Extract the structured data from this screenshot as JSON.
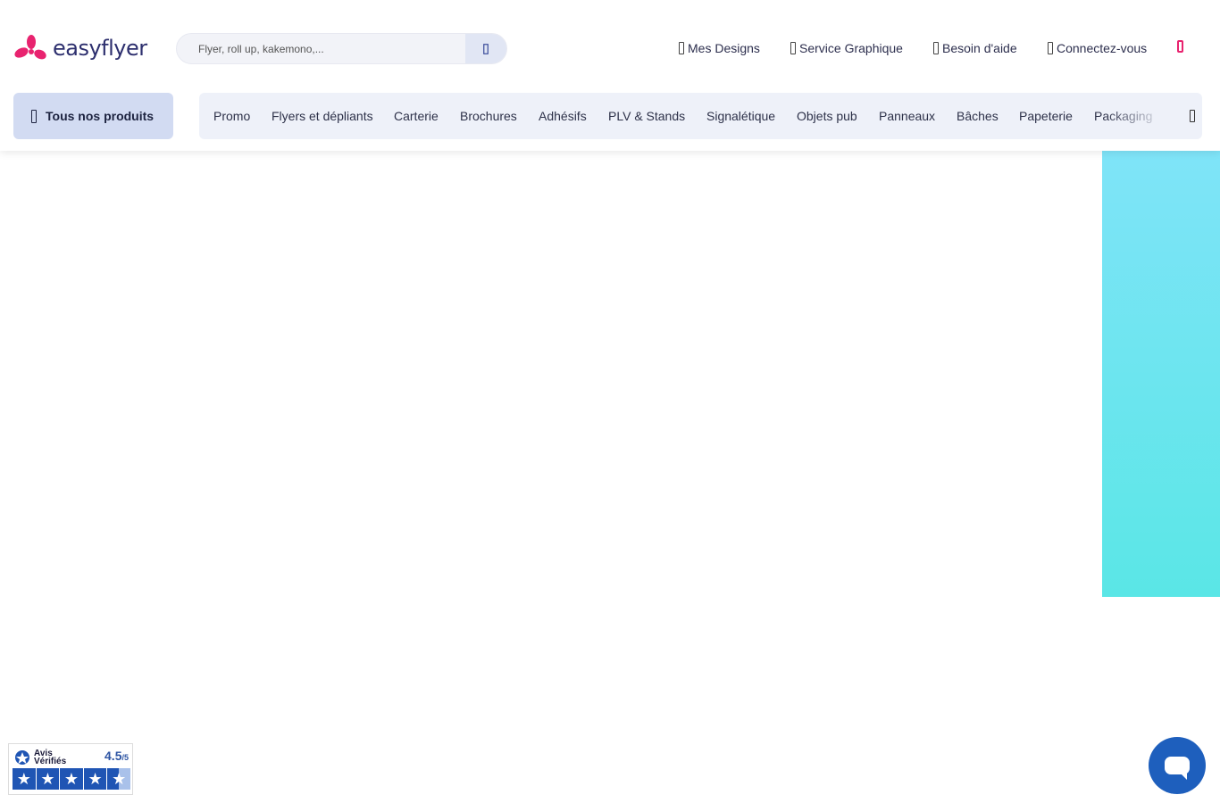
{
  "brand": {
    "name": "easyflyer",
    "accent": "#e8236f",
    "navy": "#2d2f6e"
  },
  "search": {
    "placeholder": "Flyer, roll up, kakemono,..."
  },
  "top_links": [
    {
      "label": "Mes Designs",
      "icon": "designs-icon"
    },
    {
      "label": "Service Graphique",
      "icon": "graphic-service-icon"
    },
    {
      "label": "Besoin d'aide",
      "icon": "help-icon"
    },
    {
      "label": "Connectez-vous",
      "icon": "user-icon"
    }
  ],
  "cart": {
    "icon": "cart-icon"
  },
  "all_products": {
    "label": "Tous nos produits",
    "icon": "menu-icon"
  },
  "categories": [
    "Promo",
    "Flyers et dépliants",
    "Carterie",
    "Brochures",
    "Adhésifs",
    "PLV & Stands",
    "Signalétique",
    "Objets pub",
    "Panneaux",
    "Bâches",
    "Papeterie",
    "Packaging"
  ],
  "reviews": {
    "brand_line1": "Avis",
    "brand_line2": "Vérifiés",
    "score": "4.5",
    "scale": "/5",
    "rating": 4.5,
    "max": 5
  },
  "chat": {
    "icon": "chat-icon"
  }
}
